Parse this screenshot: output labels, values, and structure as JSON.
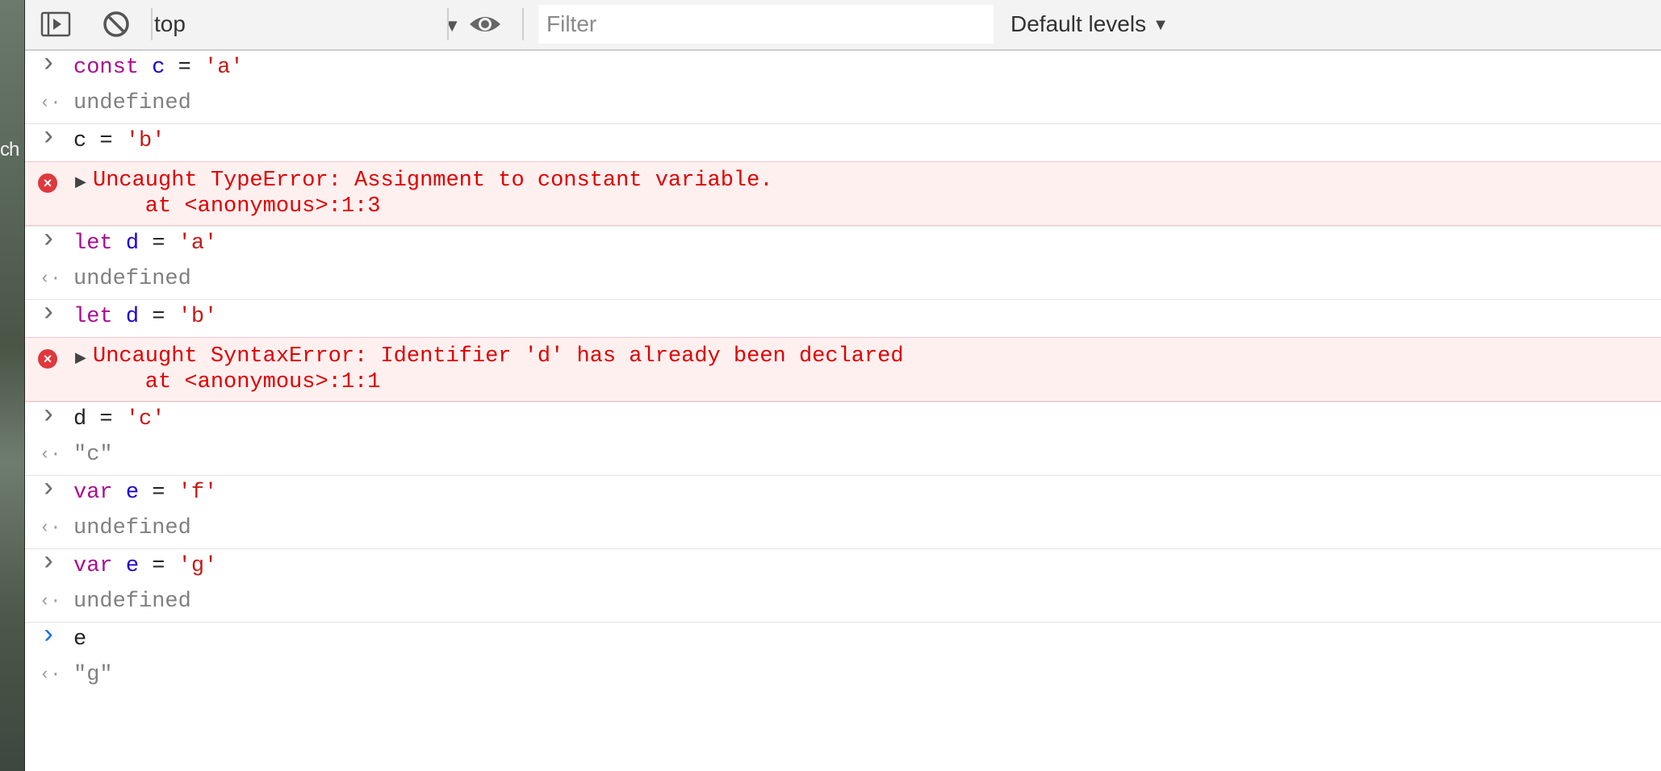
{
  "background": {
    "fragment_text": "ch"
  },
  "toolbar": {
    "context": "top",
    "filter_placeholder": "Filter",
    "levels_label": "Default levels",
    "levels_arrow": "▼"
  },
  "console": {
    "entries": [
      {
        "type": "input",
        "tokens": [
          [
            "kw",
            "const"
          ],
          [
            "op",
            " "
          ],
          [
            "id",
            "c"
          ],
          [
            "op",
            " = "
          ],
          [
            "str",
            "'a'"
          ]
        ]
      },
      {
        "type": "result",
        "text": "undefined"
      },
      {
        "type": "input",
        "tokens": [
          [
            "plain",
            "c"
          ],
          [
            "op",
            " = "
          ],
          [
            "str",
            "'b'"
          ]
        ]
      },
      {
        "type": "error",
        "line1": "Uncaught TypeError: Assignment to constant variable.",
        "line2": "at <anonymous>:1:3"
      },
      {
        "type": "input",
        "tokens": [
          [
            "kw",
            "let"
          ],
          [
            "op",
            " "
          ],
          [
            "id",
            "d"
          ],
          [
            "op",
            " = "
          ],
          [
            "str",
            "'a'"
          ]
        ]
      },
      {
        "type": "result",
        "text": "undefined"
      },
      {
        "type": "input",
        "tokens": [
          [
            "kw",
            "let"
          ],
          [
            "op",
            " "
          ],
          [
            "id",
            "d"
          ],
          [
            "op",
            " = "
          ],
          [
            "str",
            "'b'"
          ]
        ]
      },
      {
        "type": "error",
        "line1": "Uncaught SyntaxError: Identifier 'd' has already been declared",
        "line2": "at <anonymous>:1:1"
      },
      {
        "type": "input",
        "tokens": [
          [
            "plain",
            "d"
          ],
          [
            "op",
            " = "
          ],
          [
            "str",
            "'c'"
          ]
        ]
      },
      {
        "type": "result",
        "text": "\"c\"",
        "style": "res-str"
      },
      {
        "type": "input",
        "tokens": [
          [
            "kw",
            "var"
          ],
          [
            "op",
            " "
          ],
          [
            "id",
            "e"
          ],
          [
            "op",
            " = "
          ],
          [
            "str",
            "'f'"
          ]
        ]
      },
      {
        "type": "result",
        "text": "undefined"
      },
      {
        "type": "input",
        "tokens": [
          [
            "kw",
            "var"
          ],
          [
            "op",
            " "
          ],
          [
            "id",
            "e"
          ],
          [
            "op",
            " = "
          ],
          [
            "str",
            "'g'"
          ]
        ]
      },
      {
        "type": "result",
        "text": "undefined"
      },
      {
        "type": "input",
        "tokens": [
          [
            "plain",
            "e"
          ]
        ],
        "active": true
      },
      {
        "type": "result",
        "text": "\"g\"",
        "style": "res-str-red"
      }
    ]
  },
  "icons": {
    "prompt": "chevron-right-icon",
    "result": "return-arrow-icon",
    "error": "error-circle-icon",
    "expand": "triangle-right-icon"
  },
  "colors": {
    "keyword": "#aa0d91",
    "identifier": "#1c00cf",
    "string": "#c41a16",
    "error_text": "#e00000",
    "error_bg": "#fff0f0",
    "active_prompt": "#1a73e8"
  }
}
